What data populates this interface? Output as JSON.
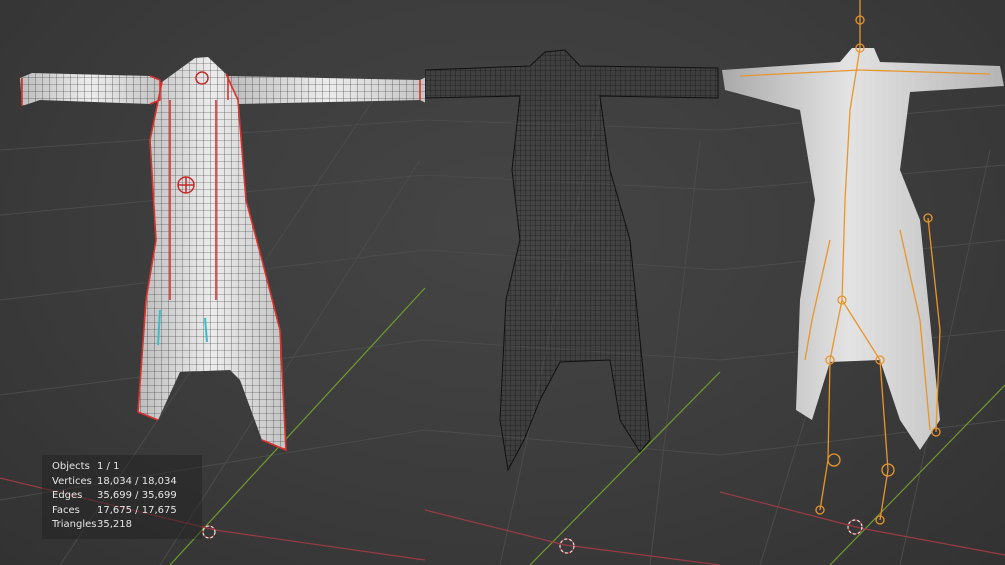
{
  "stats": [
    {
      "label": "Objects",
      "value": "1 / 1"
    },
    {
      "label": "Vertices",
      "value": "18,034 / 18,034"
    },
    {
      "label": "Edges",
      "value": "35,699 / 35,699"
    },
    {
      "label": "Faces",
      "value": "17,675 / 17,675"
    },
    {
      "label": "Triangles",
      "value": "35,218"
    }
  ],
  "colors": {
    "background": "#3d3d3d",
    "grid": "#4a4a4a",
    "y_axis": "#6f9a2e",
    "x_axis": "#9a3a45",
    "seam": "#d8322e",
    "wire": "#151515",
    "bone": "#e8952e",
    "mesh_light": "#e6e6e6"
  },
  "viewports": [
    {
      "shading": "solid-wireframe-overlay",
      "label_icon": "3d-cursor-icon"
    },
    {
      "shading": "wireframe",
      "label_icon": "3d-cursor-icon"
    },
    {
      "shading": "solid-with-armature",
      "label_icon": "3d-cursor-icon"
    }
  ]
}
